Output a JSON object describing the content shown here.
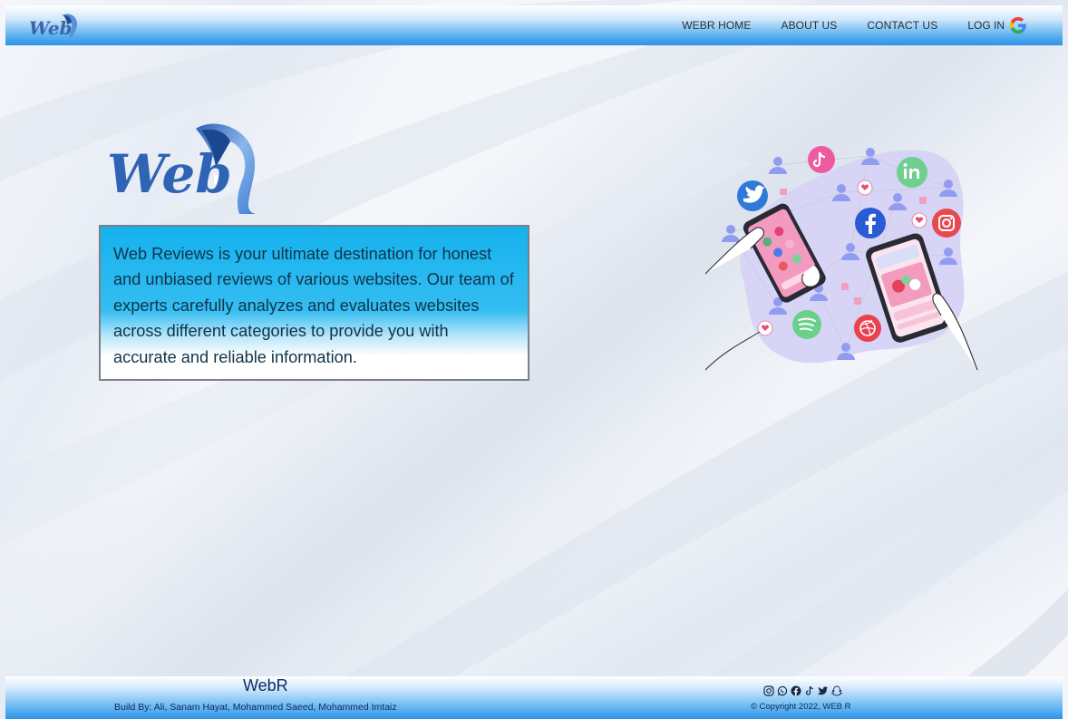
{
  "header": {
    "logo_text": "Web",
    "nav": [
      {
        "label": "WEBR HOME"
      },
      {
        "label": "ABOUT US"
      },
      {
        "label": "CONTACT US"
      }
    ],
    "login_label": "LOG IN"
  },
  "main": {
    "logo_text": "Web",
    "intro": "Web Reviews is your ultimate destination for honest and unbiased reviews of various websites. Our team of experts carefully analyzes and evaluates websites across different categories to provide you with accurate and reliable information."
  },
  "footer": {
    "brand": "WebR",
    "credits": "Build By: Ali, Sanam Hayat, Mohammed Saeed, Mohammed Imtaiz",
    "copyright": "© Copyright 2022, WEB R",
    "social_icons": [
      "instagram-icon",
      "whatsapp-icon",
      "facebook-icon",
      "tiktok-icon",
      "twitter-icon",
      "snapchat-icon"
    ]
  },
  "colors": {
    "header_gradient_end": "#2d92e6",
    "intro_box": "#15b2ee",
    "text_dark": "#10334a",
    "footer_text": "#0f2a66"
  }
}
